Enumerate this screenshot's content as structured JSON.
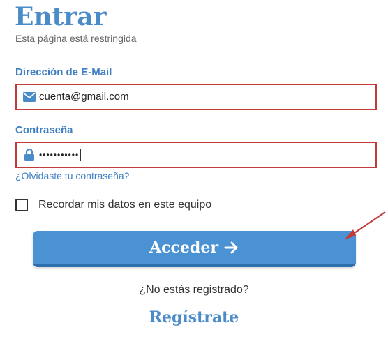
{
  "header": {
    "title": "Entrar",
    "subtitle": "Esta página está restringida"
  },
  "form": {
    "email": {
      "label": "Dirección de E-Mail",
      "value": "cuenta@gmail.com",
      "icon": "envelope-icon"
    },
    "password": {
      "label": "Contraseña",
      "value": "•••••••••••",
      "icon": "lock-icon"
    },
    "forgot_link": "¿Olvidaste tu contraseña?",
    "remember_label": "Recordar mis datos en este equipo",
    "remember_checked": false,
    "submit_label": "Acceder",
    "submit_icon": "arrow-right-icon"
  },
  "footer": {
    "not_registered": "¿No estás registrado?",
    "register_link": "Regístrate"
  },
  "colors": {
    "brand_blue": "#4a8bc8",
    "button_blue": "#4b92d4",
    "highlight_red": "#c23b3b"
  }
}
